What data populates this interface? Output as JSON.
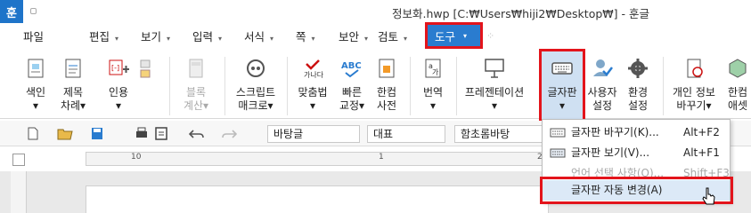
{
  "titlebar": {
    "app_logo": "훈",
    "title": "정보화.hwp [C:₩Users₩hiji2₩Desktop₩] - 훈글"
  },
  "menubar": {
    "items": [
      {
        "label": "파일"
      },
      {
        "label": "편집"
      },
      {
        "label": "보기"
      },
      {
        "label": "입력"
      },
      {
        "label": "서식"
      },
      {
        "label": "쪽"
      },
      {
        "label": "보안"
      },
      {
        "label": "검토"
      }
    ],
    "active": {
      "label": "도구"
    }
  },
  "ribbon": {
    "buttons": [
      {
        "label": "색인\n▾"
      },
      {
        "label": "제목\n차례▾"
      },
      {
        "label": "인용\n▾"
      },
      {
        "label": "블록\n계산▾"
      },
      {
        "label": "스크립트\n매크로▾"
      },
      {
        "label": "맞춤법\n▾"
      },
      {
        "label": "빠른\n교정▾"
      },
      {
        "label": "한컴\n사전"
      },
      {
        "label": "번역\n▾"
      },
      {
        "label": "프레젠테이션\n▾"
      },
      {
        "label": "글자판\n▾"
      },
      {
        "label": "사용자\n설정"
      },
      {
        "label": "환경\n설정"
      },
      {
        "label": "개인 정보\n바꾸기▾"
      },
      {
        "label": "한컴\n애셋"
      }
    ]
  },
  "toolbar": {
    "style_combo": "바탕글",
    "para_combo": "대표",
    "font_combo": "함초롬바탕"
  },
  "ruler": {
    "numbers": [
      "10",
      "1",
      "2"
    ]
  },
  "dropdown": {
    "items": [
      {
        "label": "글자판 바꾸기(K)...",
        "shortcut": "Alt+F2",
        "enabled": true
      },
      {
        "label": "글자판 보기(V)...",
        "shortcut": "Alt+F1",
        "enabled": true
      },
      {
        "label": "언어 선택 사항(O)...",
        "shortcut": "Shift+F3",
        "enabled": false
      },
      {
        "label": "글자판 자동 변경(A)",
        "shortcut": "",
        "enabled": true
      }
    ]
  },
  "colors": {
    "accent": "#2a7ccf",
    "highlight_box": "#e3141b",
    "hover": "#dce9f7"
  }
}
